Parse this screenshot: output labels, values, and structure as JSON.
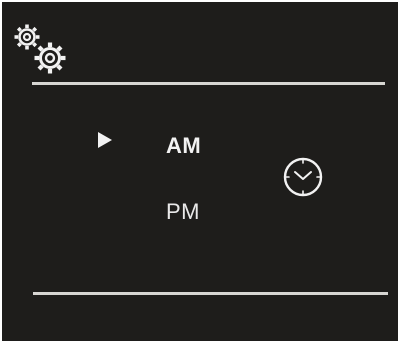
{
  "settings": {
    "icon": "gears-icon"
  },
  "time_format": {
    "options": [
      {
        "label": "AM",
        "selected": true
      },
      {
        "label": "PM",
        "selected": false
      }
    ],
    "selector_icon": "triangle-right-icon",
    "clock_icon": "clock-icon"
  },
  "colors": {
    "background": "#1e1d1b",
    "foreground": "#f2f2f2",
    "divider": "#d7d6d2"
  }
}
